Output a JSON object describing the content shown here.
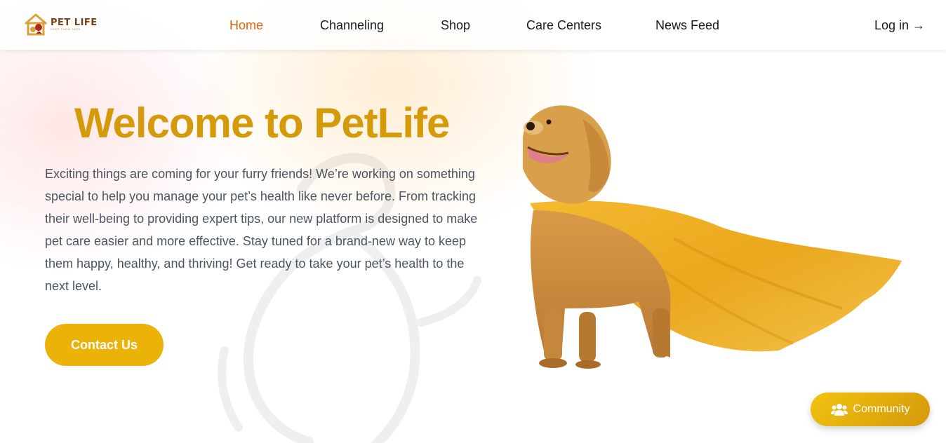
{
  "brand": {
    "name": "PET LIFE",
    "tagline": "KEEP THEM SAFE"
  },
  "nav": {
    "items": [
      {
        "label": "Home",
        "active": true
      },
      {
        "label": "Channeling",
        "active": false
      },
      {
        "label": "Shop",
        "active": false
      },
      {
        "label": "Care Centers",
        "active": false
      },
      {
        "label": "News Feed",
        "active": false
      }
    ],
    "login_label": "Log in →"
  },
  "hero": {
    "title": "Welcome to PetLife",
    "description": "Exciting things are coming for your furry friends! We’re working on something special to help you manage your pet’s health like never before. From tracking their well-being to providing expert tips, our new platform is designed to make pet care easier and more effective. Stay tuned for a brand-new way to keep them happy, healthy, and thriving! Get ready to take your pet’s health to the next level.",
    "cta_label": "Contact Us",
    "image_icon": "golden-retriever-with-cape"
  },
  "community": {
    "label": "Community",
    "icon": "users-icon"
  },
  "colors": {
    "accent": "#ebb308",
    "title": "#d49a0a",
    "active_nav": "#e0620f",
    "body_text": "#4b5563"
  }
}
